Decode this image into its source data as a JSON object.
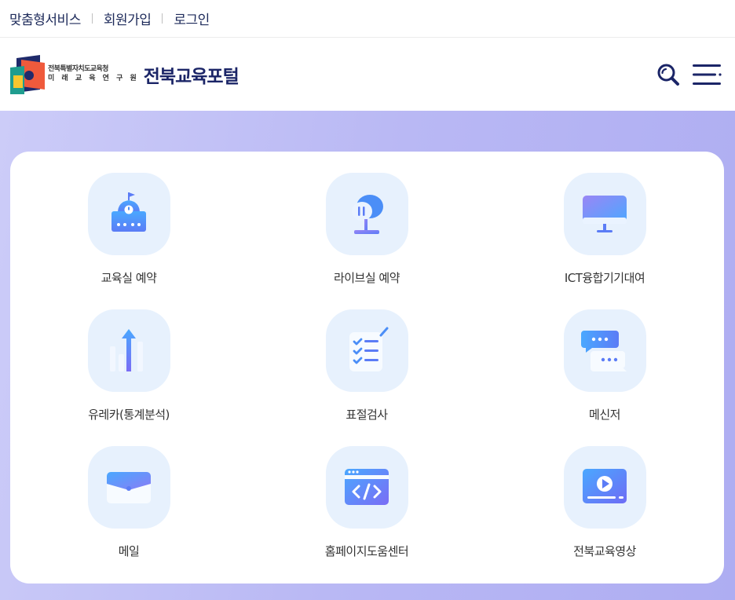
{
  "topbar": {
    "links": [
      "맞춤형서비스",
      "회원가입",
      "로그인"
    ]
  },
  "header": {
    "org_line1": "전북특별자치도교육청",
    "org_line2": "미 래 교 육 연 구 원",
    "site_title": "전북교육포털",
    "search_icon": "search-icon",
    "menu_icon": "hamburger-menu-icon"
  },
  "services": [
    {
      "label": "교육실 예약",
      "icon": "classroom-icon"
    },
    {
      "label": "라이브실 예약",
      "icon": "microphone-icon"
    },
    {
      "label": "ICT융합기기대여",
      "icon": "monitor-icon"
    },
    {
      "label": "유레카(통계분석)",
      "icon": "bar-chart-icon"
    },
    {
      "label": "표절검사",
      "icon": "checklist-icon"
    },
    {
      "label": "메신저",
      "icon": "chat-bubbles-icon"
    },
    {
      "label": "메일",
      "icon": "envelope-icon"
    },
    {
      "label": "홈페이지도움센터",
      "icon": "code-window-icon"
    },
    {
      "label": "전북교육영상",
      "icon": "video-player-icon"
    }
  ],
  "colors": {
    "brand_navy": "#1b2567",
    "icon_blue": "#4b8ef7",
    "icon_bg": "#e7f1fd",
    "hero_purple": "#b9b8f4"
  }
}
